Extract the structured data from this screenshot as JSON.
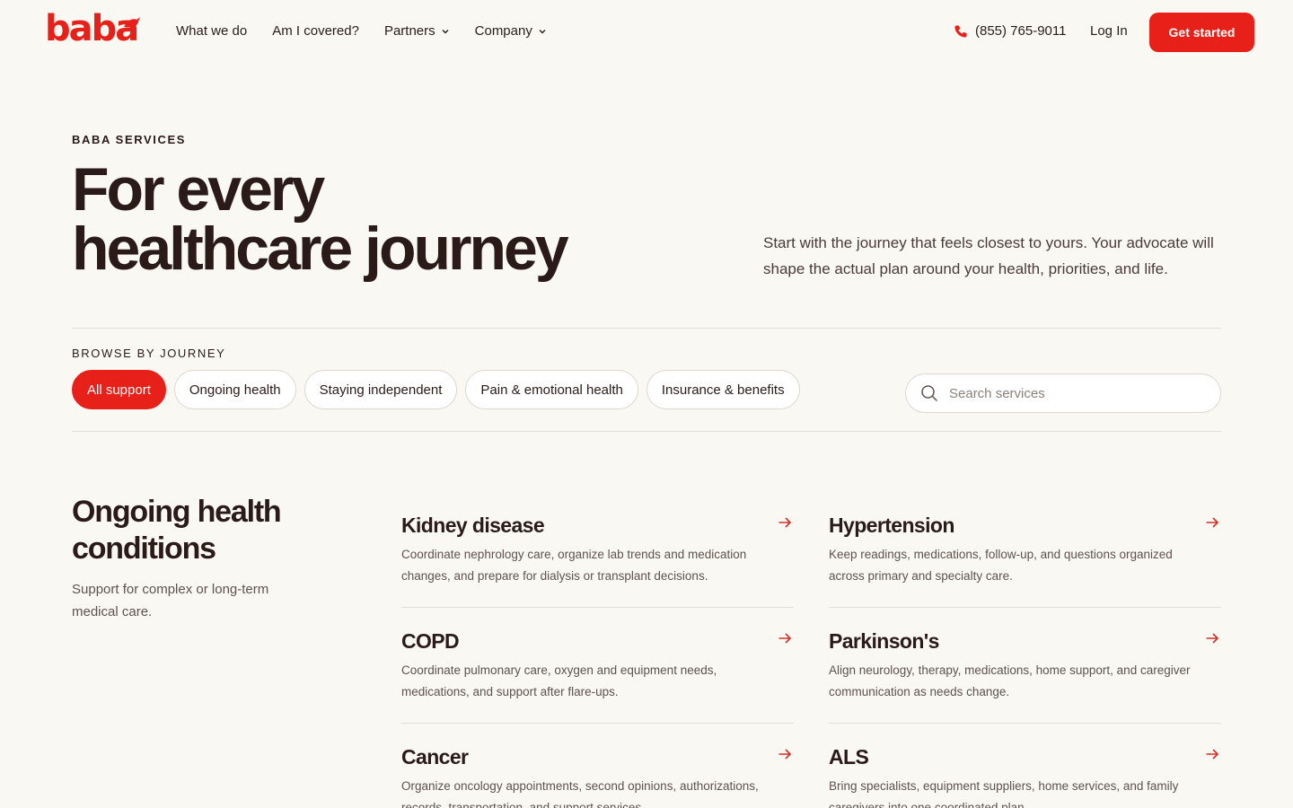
{
  "brand": {
    "logo_text": "baba",
    "accent": "#e8201a"
  },
  "nav": {
    "items": [
      {
        "label": "What we do",
        "has_dropdown": false
      },
      {
        "label": "Am I covered?",
        "has_dropdown": false
      },
      {
        "label": "Partners",
        "has_dropdown": true
      },
      {
        "label": "Company",
        "has_dropdown": true
      }
    ],
    "phone": "(855) 765-9011",
    "login": "Log In",
    "cta": "Get started"
  },
  "hero": {
    "eyebrow": "BABA SERVICES",
    "title_line1": "For every",
    "title_line2": "healthcare journey",
    "description": "Start with the journey that feels closest to yours. Your advocate will shape the actual plan around your health, priorities, and life."
  },
  "browse": {
    "label": "BROWSE BY JOURNEY",
    "chips": [
      "All support",
      "Ongoing health",
      "Staying independent",
      "Pain & emotional health",
      "Insurance & benefits"
    ],
    "active_index": 0,
    "search_placeholder": "Search services"
  },
  "section": {
    "title": "Ongoing health conditions",
    "description": "Support for complex or long-term medical care.",
    "cards": [
      {
        "title": "Kidney disease",
        "description": "Coordinate nephrology care, organize lab trends and medication changes, and prepare for dialysis or transplant decisions."
      },
      {
        "title": "Hypertension",
        "description": "Keep readings, medications, follow-up, and questions organized across primary and specialty care."
      },
      {
        "title": "COPD",
        "description": "Coordinate pulmonary care, oxygen and equipment needs, medications, and support after flare-ups."
      },
      {
        "title": "Parkinson's",
        "description": "Align neurology, therapy, medications, home support, and caregiver communication as needs change."
      },
      {
        "title": "Cancer",
        "description": "Organize oncology appointments, second opinions, authorizations, records, transportation, and support services."
      },
      {
        "title": "ALS",
        "description": "Bring specialists, equipment suppliers, home services, and family caregivers into one coordinated plan."
      }
    ]
  }
}
